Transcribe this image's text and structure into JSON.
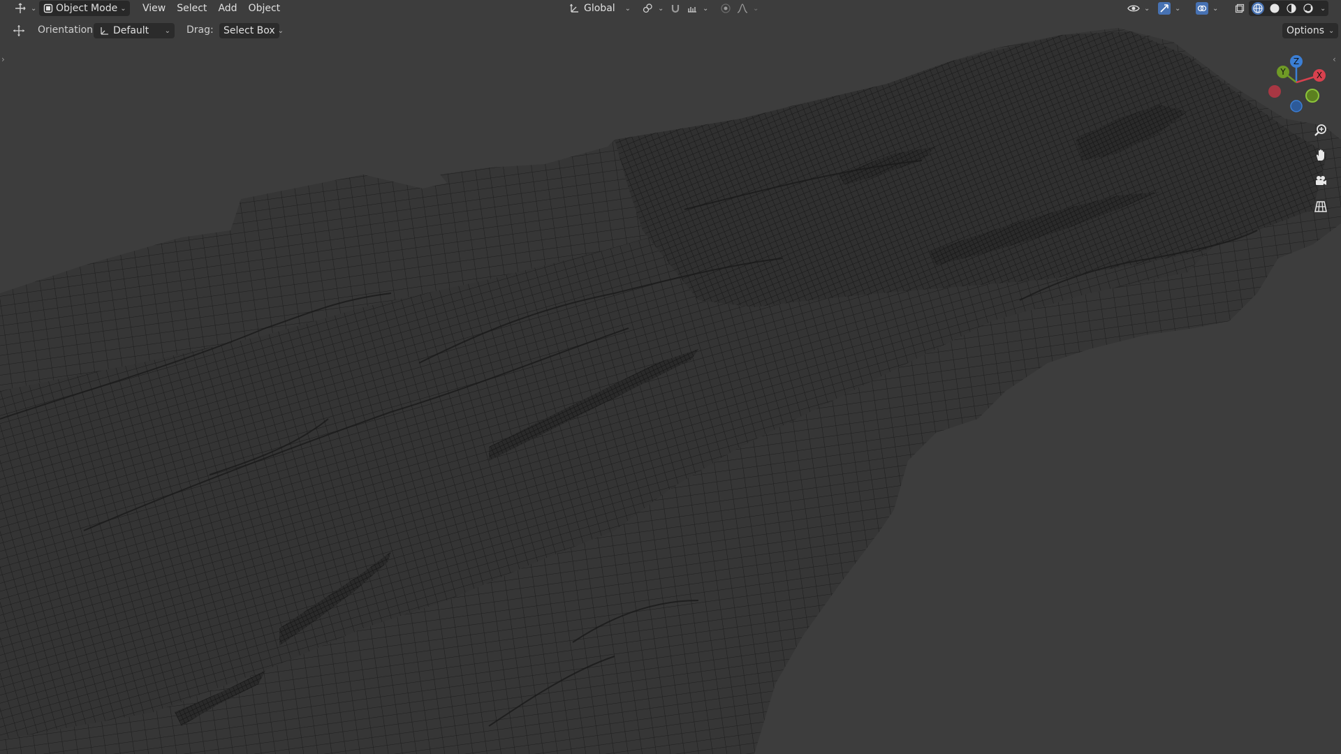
{
  "header": {
    "editor_type_icon": "cursor-transform-icon",
    "mode": {
      "label": "Object Mode",
      "icon": "object-mode-icon"
    },
    "menus": [
      "View",
      "Select",
      "Add",
      "Object"
    ],
    "transform_orientation": {
      "label": "Global",
      "icon": "transform-axes-icon"
    },
    "pivot_icon": "link-icon",
    "snap_icon": "magnet-icon",
    "snap_target_icon": "snap-increment-icon",
    "proportional_icon": "proportional-dot-icon",
    "falloff_icon": "falloff-curve-icon",
    "visibility_icon": "eye-icon",
    "gizmo_icon": "gizmo-arrow-icon",
    "overlay_icon": "overlay-circles-icon",
    "xray_icon": "xray-toggle-icon",
    "shading_modes": [
      {
        "name": "wireframe",
        "active": true
      },
      {
        "name": "solid",
        "active": false
      },
      {
        "name": "material",
        "active": false
      },
      {
        "name": "rendered",
        "active": false
      }
    ]
  },
  "tool_header": {
    "tool_icon": "move-tool-icon",
    "orientation_label": "Orientation:",
    "orientation_value": "Default",
    "drag_label": "Drag:",
    "drag_value": "Select Box",
    "options_label": "Options"
  },
  "navigation_gizmo": {
    "axes": [
      {
        "label": "Z",
        "color": "#3b7fd6"
      },
      {
        "label": "Y",
        "color": "#6f9a26"
      },
      {
        "label": "X",
        "color": "#d8414e"
      }
    ]
  },
  "nav_buttons": [
    {
      "name": "zoom-icon"
    },
    {
      "name": "pan-hand-icon"
    },
    {
      "name": "camera-view-icon"
    },
    {
      "name": "perspective-grid-icon"
    }
  ],
  "colors": {
    "viewport_bg": "#3d3d3d",
    "mesh_fill": "#333333",
    "wire": "#1a1a1a",
    "accent_blue": "#4772b3"
  }
}
